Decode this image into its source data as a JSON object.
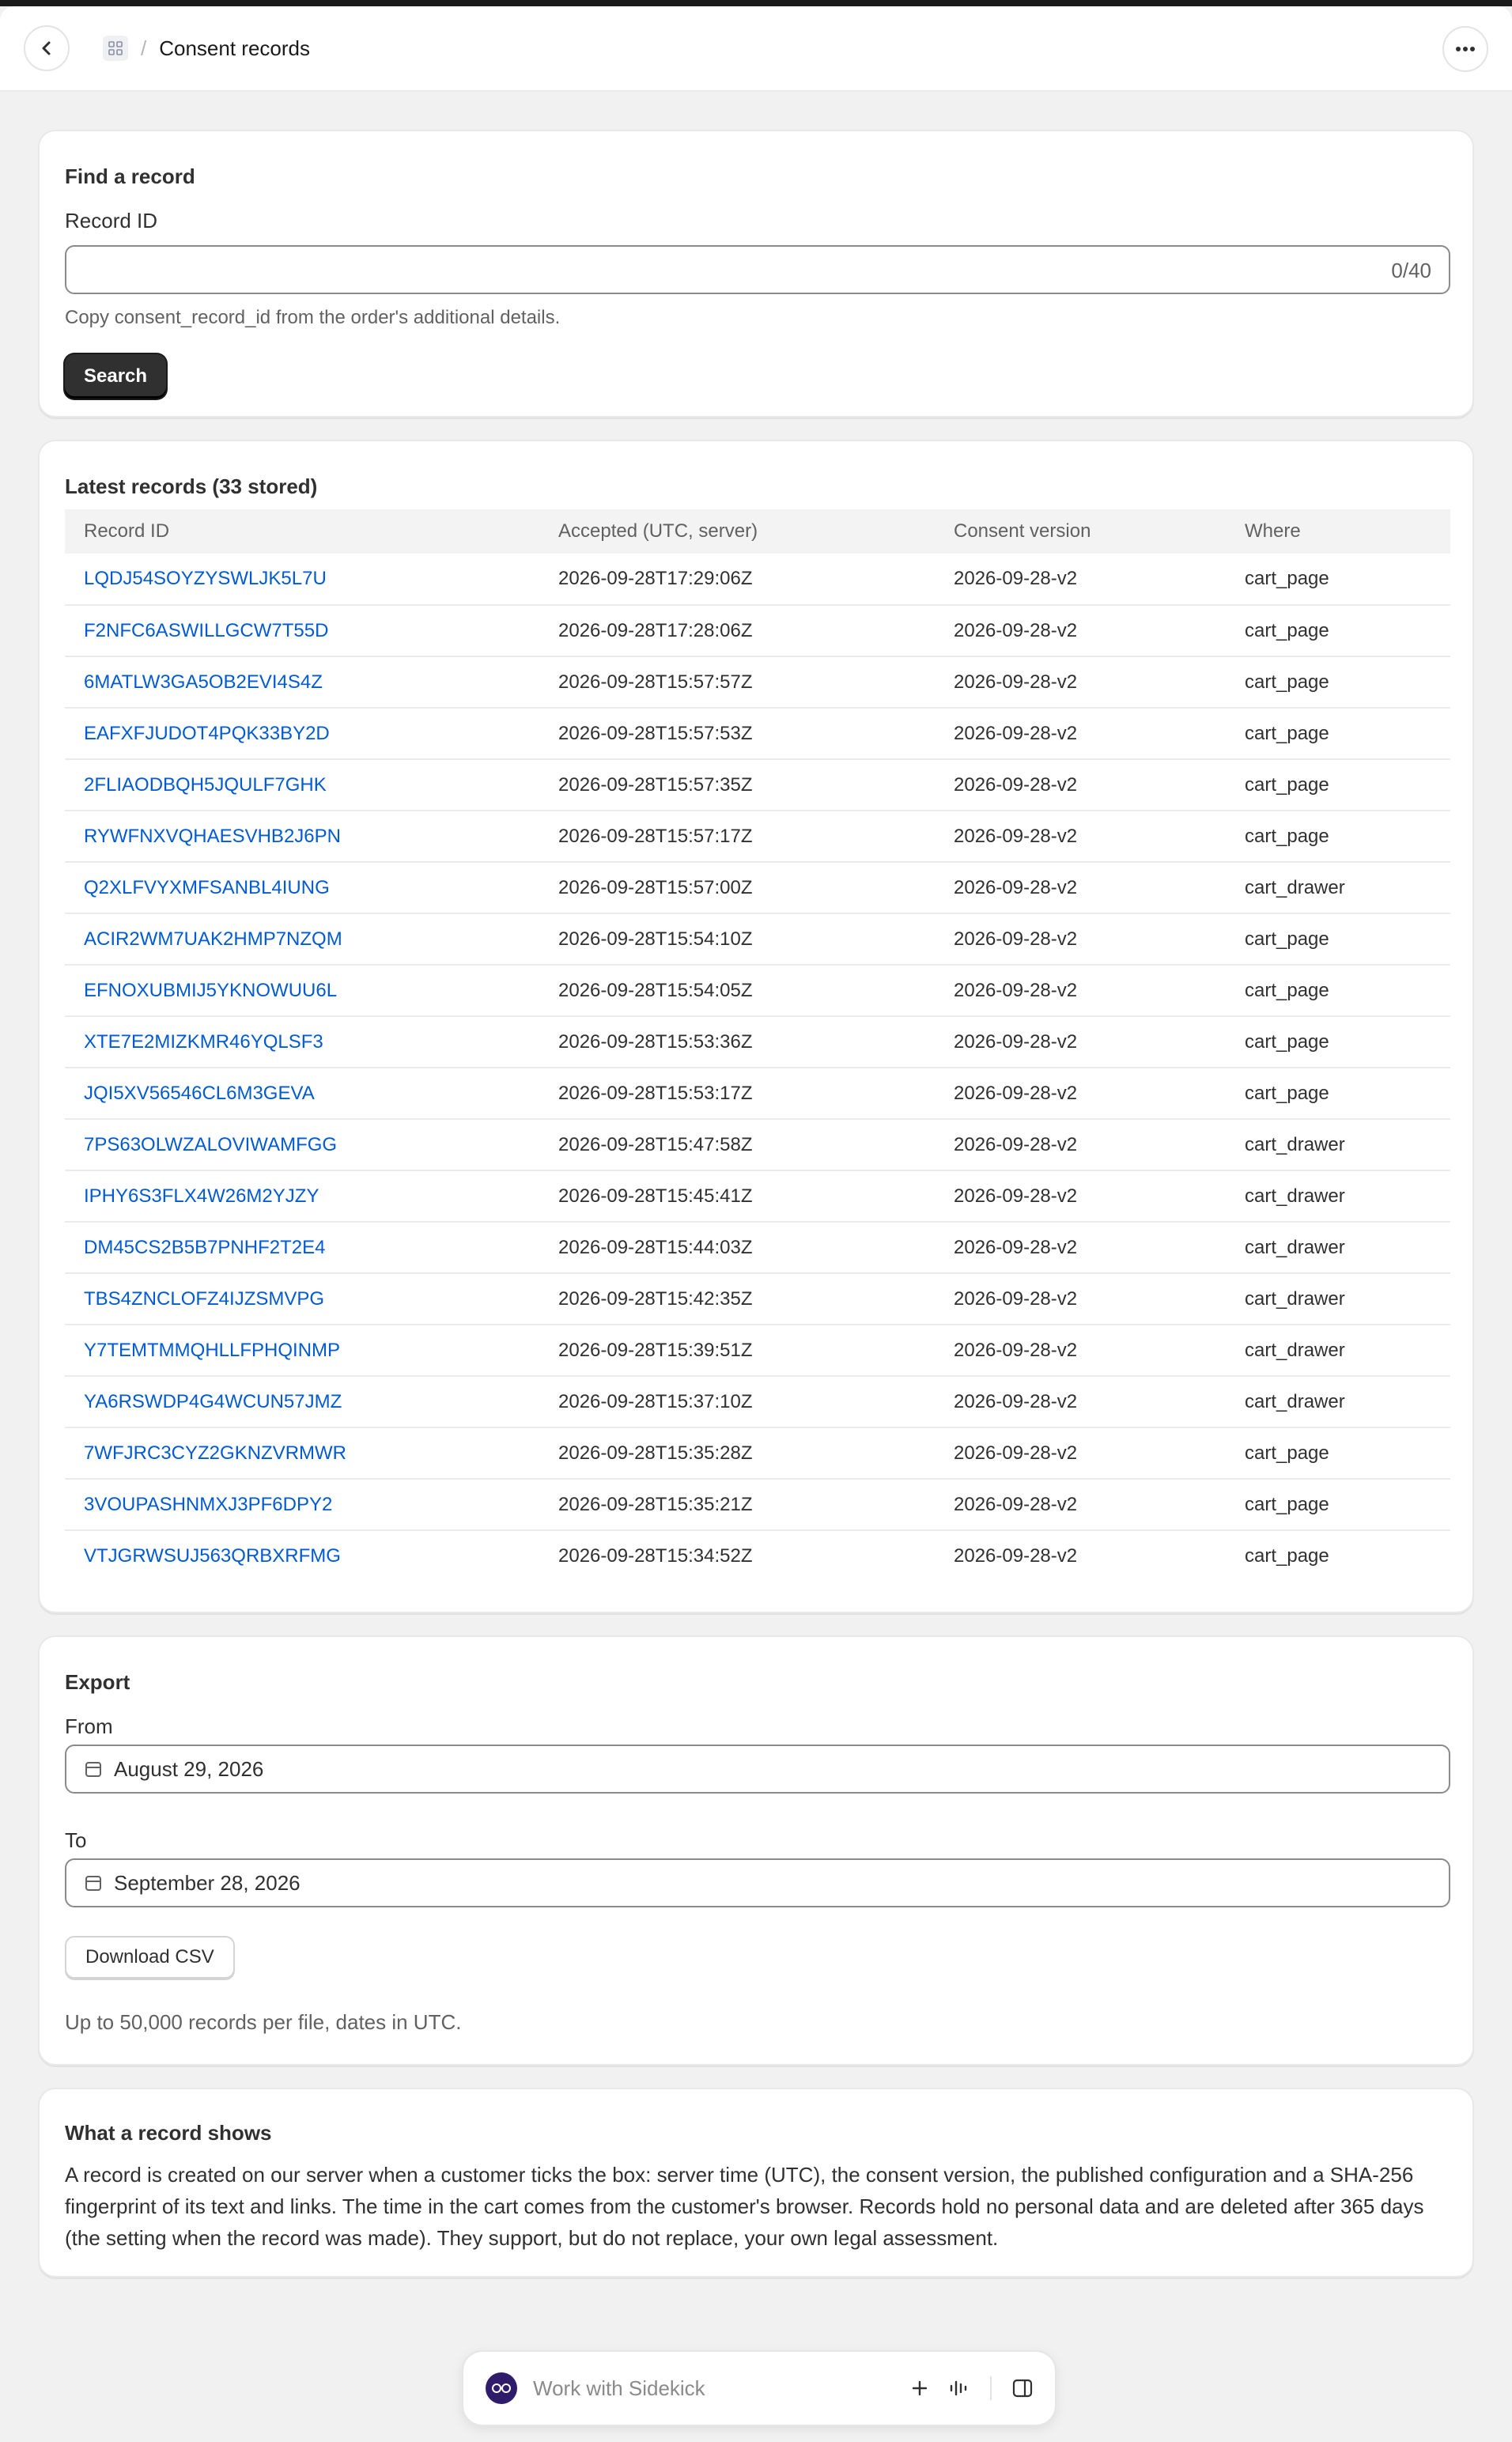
{
  "header": {
    "title": "Consent records",
    "separator": "/"
  },
  "find": {
    "title": "Find a record",
    "field_label": "Record ID",
    "field_value": "",
    "counter": "0/40",
    "help": "Copy consent_record_id from the order's additional details.",
    "search_label": "Search"
  },
  "latest": {
    "title": "Latest records (33 stored)",
    "columns": [
      "Record ID",
      "Accepted (UTC, server)",
      "Consent version",
      "Where"
    ],
    "rows": [
      [
        "LQDJ54SOYZYSWLJK5L7U",
        "2026-09-28T17:29:06Z",
        "2026-09-28-v2",
        "cart_page"
      ],
      [
        "F2NFC6ASWILLGCW7T55D",
        "2026-09-28T17:28:06Z",
        "2026-09-28-v2",
        "cart_page"
      ],
      [
        "6MATLW3GA5OB2EVI4S4Z",
        "2026-09-28T15:57:57Z",
        "2026-09-28-v2",
        "cart_page"
      ],
      [
        "EAFXFJUDOT4PQK33BY2D",
        "2026-09-28T15:57:53Z",
        "2026-09-28-v2",
        "cart_page"
      ],
      [
        "2FLIAODBQH5JQULF7GHK",
        "2026-09-28T15:57:35Z",
        "2026-09-28-v2",
        "cart_page"
      ],
      [
        "RYWFNXVQHAESVHB2J6PN",
        "2026-09-28T15:57:17Z",
        "2026-09-28-v2",
        "cart_page"
      ],
      [
        "Q2XLFVYXMFSANBL4IUNG",
        "2026-09-28T15:57:00Z",
        "2026-09-28-v2",
        "cart_drawer"
      ],
      [
        "ACIR2WM7UAK2HMP7NZQM",
        "2026-09-28T15:54:10Z",
        "2026-09-28-v2",
        "cart_page"
      ],
      [
        "EFNOXUBMIJ5YKNOWUU6L",
        "2026-09-28T15:54:05Z",
        "2026-09-28-v2",
        "cart_page"
      ],
      [
        "XTE7E2MIZKMR46YQLSF3",
        "2026-09-28T15:53:36Z",
        "2026-09-28-v2",
        "cart_page"
      ],
      [
        "JQI5XV56546CL6M3GEVA",
        "2026-09-28T15:53:17Z",
        "2026-09-28-v2",
        "cart_page"
      ],
      [
        "7PS63OLWZALOVIWAMFGG",
        "2026-09-28T15:47:58Z",
        "2026-09-28-v2",
        "cart_drawer"
      ],
      [
        "IPHY6S3FLX4W26M2YJZY",
        "2026-09-28T15:45:41Z",
        "2026-09-28-v2",
        "cart_drawer"
      ],
      [
        "DM45CS2B5B7PNHF2T2E4",
        "2026-09-28T15:44:03Z",
        "2026-09-28-v2",
        "cart_drawer"
      ],
      [
        "TBS4ZNCLOFZ4IJZSMVPG",
        "2026-09-28T15:42:35Z",
        "2026-09-28-v2",
        "cart_drawer"
      ],
      [
        "Y7TEMTMMQHLLFPHQINMP",
        "2026-09-28T15:39:51Z",
        "2026-09-28-v2",
        "cart_drawer"
      ],
      [
        "YA6RSWDP4G4WCUN57JMZ",
        "2026-09-28T15:37:10Z",
        "2026-09-28-v2",
        "cart_drawer"
      ],
      [
        "7WFJRC3CYZ2GKNZVRMWR",
        "2026-09-28T15:35:28Z",
        "2026-09-28-v2",
        "cart_page"
      ],
      [
        "3VOUPASHNMXJ3PF6DPY2",
        "2026-09-28T15:35:21Z",
        "2026-09-28-v2",
        "cart_page"
      ],
      [
        "VTJGRWSUJ563QRBXRFMG",
        "2026-09-28T15:34:52Z",
        "2026-09-28-v2",
        "cart_page"
      ]
    ]
  },
  "export": {
    "title": "Export",
    "from_label": "From",
    "from_value": "August 29, 2026",
    "to_label": "To",
    "to_value": "September 28, 2026",
    "download_label": "Download CSV",
    "note": "Up to 50,000 records per file, dates in UTC."
  },
  "about": {
    "title": "What a record shows",
    "text": "A record is created on our server when a customer ticks the box: server time (UTC), the consent version, the published configuration and a SHA-256 fingerprint of its text and links. The time in the cart comes from the customer's browser. Records hold no personal data and are deleted after 365 days (the setting when the record was made). They support, but do not replace, your own legal assessment."
  },
  "sidekick": {
    "placeholder": "Work with Sidekick"
  },
  "colors": {
    "link": "#005bd3",
    "primary_button": "#303030",
    "page_bg": "#f1f1f1"
  },
  "icons": [
    "back-arrow-icon",
    "app-grid-icon",
    "more-horizontal-icon",
    "calendar-icon",
    "sidekick-avatar-icon",
    "plus-icon",
    "voice-icon",
    "sidebar-panel-icon"
  ]
}
